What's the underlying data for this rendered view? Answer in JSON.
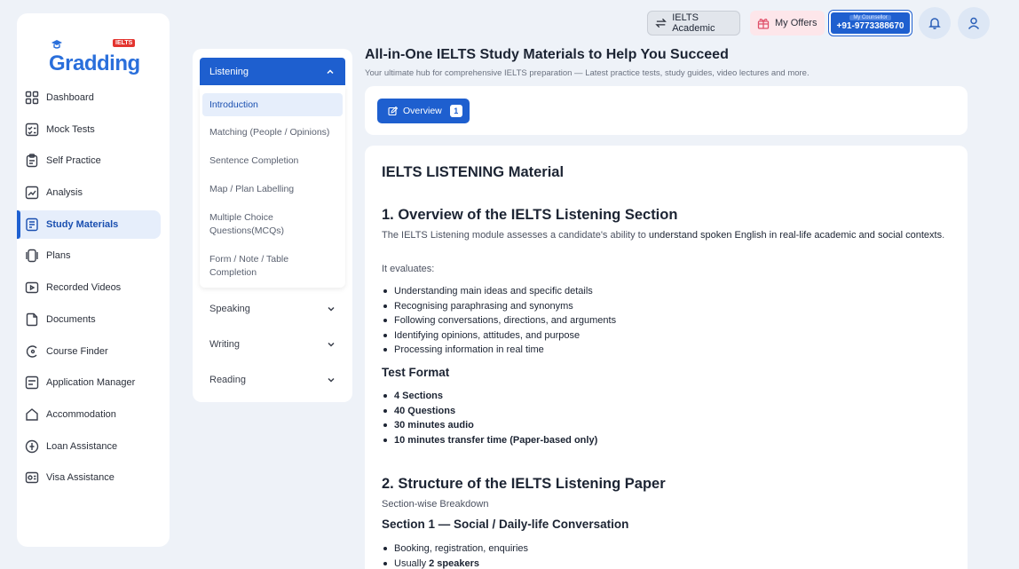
{
  "brand": {
    "name": "Gradding",
    "badge": "IELTS"
  },
  "sidebar": {
    "items": [
      {
        "label": "Dashboard",
        "icon": "grid-icon"
      },
      {
        "label": "Mock Tests",
        "icon": "checklist-icon"
      },
      {
        "label": "Self Practice",
        "icon": "clipboard-icon"
      },
      {
        "label": "Analysis",
        "icon": "chart-icon"
      },
      {
        "label": "Study Materials",
        "icon": "book-icon"
      },
      {
        "label": "Plans",
        "icon": "cards-icon"
      },
      {
        "label": "Recorded Videos",
        "icon": "video-icon"
      },
      {
        "label": "Documents",
        "icon": "documents-icon"
      },
      {
        "label": "Course Finder",
        "icon": "search-icon"
      },
      {
        "label": "Application Manager",
        "icon": "form-icon"
      },
      {
        "label": "Accommodation",
        "icon": "home-icon"
      },
      {
        "label": "Loan Assistance",
        "icon": "loan-icon"
      },
      {
        "label": "Visa Assistance",
        "icon": "passport-icon"
      }
    ]
  },
  "topbar": {
    "academic": "IELTS Academic",
    "offers": "My Offers",
    "counsellor_label": "My Counsellor",
    "counsellor_phone": "+91-9773388670"
  },
  "header": {
    "title": "All-in-One IELTS Study Materials to Help You Succeed",
    "subtitle": "Your ultimate hub for comprehensive IELTS preparation — Latest practice tests, study guides, video lectures and more."
  },
  "accordion": {
    "open_section": "Listening",
    "topics": [
      "Introduction",
      "Matching (People / Opinions)",
      "Sentence Completion",
      "Map / Plan Labelling",
      "Multiple Choice Questions(MCQs)",
      "Form / Note / Table Completion"
    ],
    "sections": [
      "Speaking",
      "Writing",
      "Reading"
    ]
  },
  "overview": {
    "label": "Overview",
    "count": "1"
  },
  "content": {
    "main_title": "IELTS LISTENING Material",
    "s1_title": "1. Overview of the IELTS Listening Section",
    "s1_para_a": "The IELTS Listening module assesses a candidate's ability to ",
    "s1_para_b": "understand spoken English in real-life academic and social contexts",
    "s1_para_c": ".",
    "evaluates": "It evaluates:",
    "eval_items": [
      "Understanding main ideas and specific details",
      "Recognising paraphrasing and synonyms",
      "Following conversations, directions, and arguments",
      "Identifying opinions, attitudes, and purpose",
      "Processing information in real time"
    ],
    "format_title": "Test Format",
    "format_items": [
      "4 Sections",
      "40 Questions",
      "30 minutes audio",
      "10 minutes transfer time (Paper-based only)"
    ],
    "s2_title": "2. Structure of the IELTS Listening Paper",
    "breakdown": "Section-wise Breakdown",
    "sec1_title": "Section 1 — Social / Daily-life Conversation",
    "sec1_item1": "Booking, registration, enquiries",
    "sec1_item2_a": "Usually ",
    "sec1_item2_b": "2 speakers"
  }
}
